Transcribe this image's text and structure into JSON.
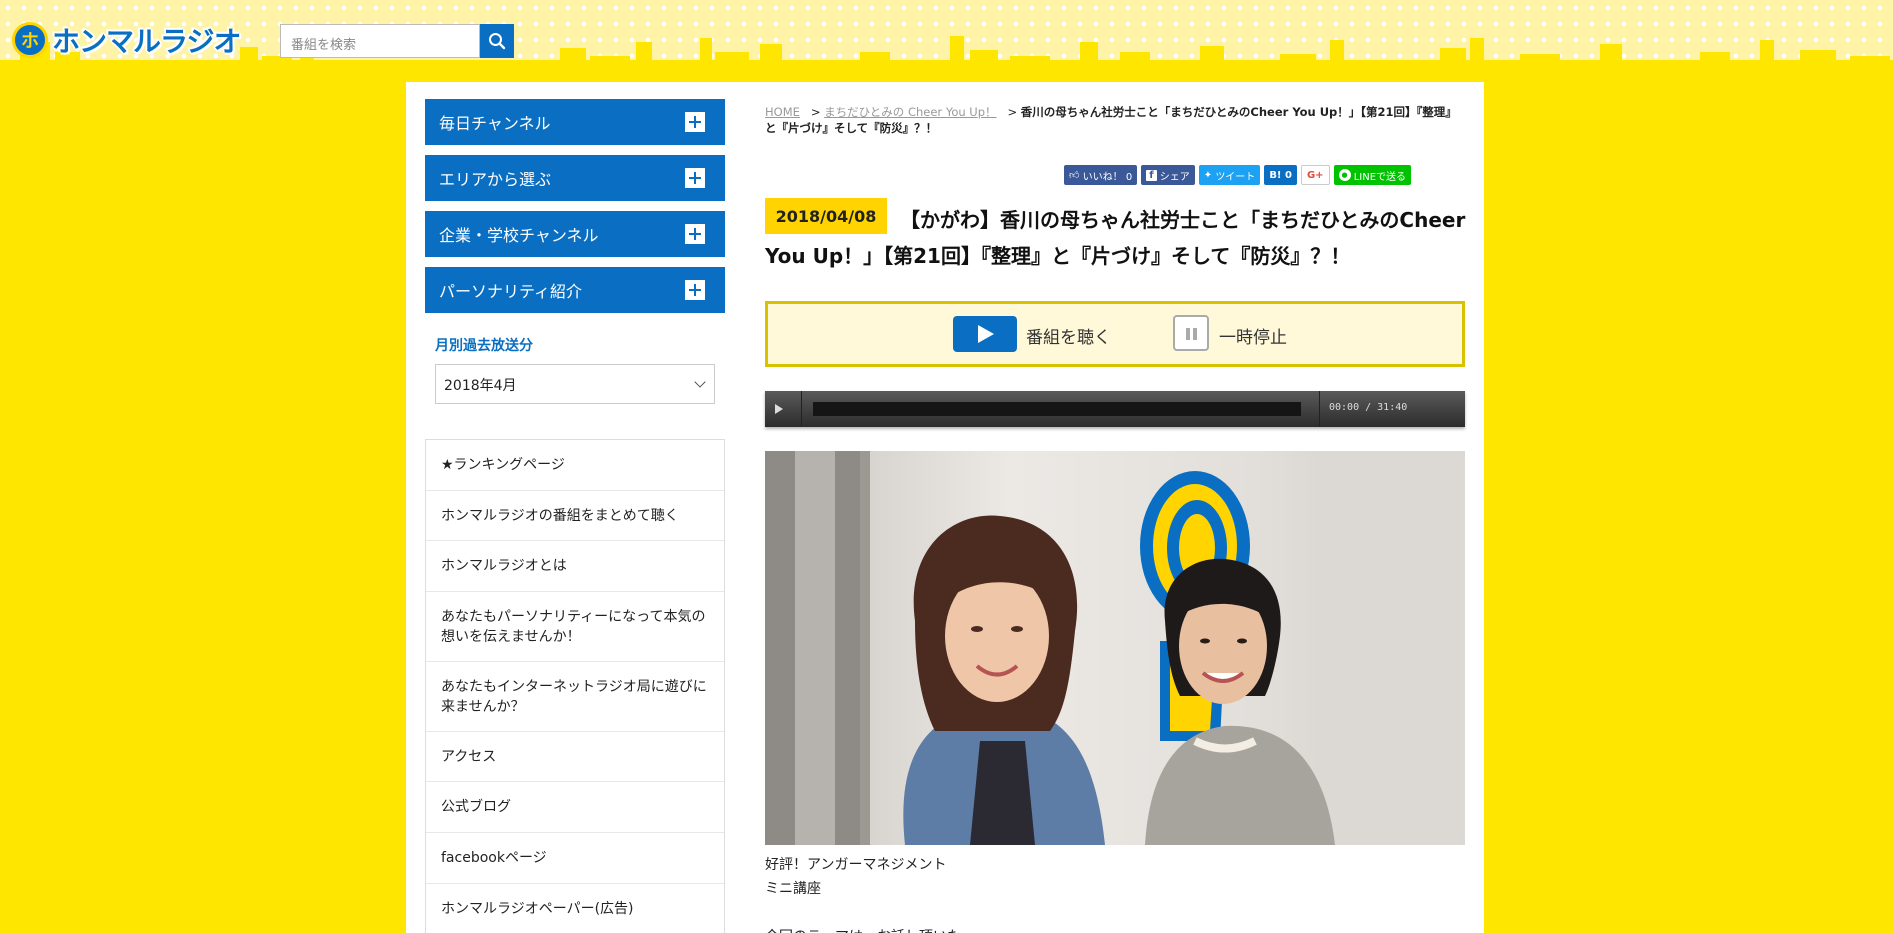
{
  "header": {
    "logo_badge": "ホ",
    "logo_text": "ホンマルラジオ",
    "search_placeholder": "番組を検索"
  },
  "sidebar": {
    "menu": [
      {
        "label": "毎日チャンネル"
      },
      {
        "label": "エリアから選ぶ"
      },
      {
        "label": "企業・学校チャンネル"
      },
      {
        "label": "パーソナリティ紹介"
      }
    ],
    "monthly_title": "月別過去放送分",
    "month_selected": "2018年4月",
    "links": [
      {
        "label": "★ランキングページ"
      },
      {
        "label": "ホンマルラジオの番組をまとめて聴く"
      },
      {
        "label": "ホンマルラジオとは"
      },
      {
        "label": "あなたもパーソナリティーになって本気の想いを伝えませんか！"
      },
      {
        "label": "あなたもインターネットラジオ局に遊びに来ませんか？"
      },
      {
        "label": "アクセス"
      },
      {
        "label": "公式ブログ"
      },
      {
        "label": "facebookページ"
      },
      {
        "label": "ホンマルラジオペーパー(広告)"
      }
    ]
  },
  "breadcrumb": {
    "home": "HOME",
    "sep": ">",
    "program": "まちだひとみの Cheer You Up！",
    "current": "香川の母ちゃん社労士こと「まちだひとみのCheer You Up！」【第21回】『整理』と『片づけ』そして『防災』？！"
  },
  "share": {
    "like": "いいね！ 0",
    "fb_share": "シェア",
    "tweet": "ツイート",
    "hatena": "B! 0",
    "gplus": "G+",
    "line": "LINEで送る"
  },
  "article": {
    "date": "2018/04/08",
    "title": "【かがわ】香川の母ちゃん社労士こと「まちだひとみのCheer You Up！」【第21回】『整理』と『片づけ』そして『防災』？！",
    "listen_label": "番組を聴く",
    "pause_label": "一時停止",
    "audio_time": "00:00 / 31:40",
    "body_lines": [
      "好評！アンガーマネジメント",
      "ミニ講座",
      "",
      "今回のテーマは、お話し頂いた"
    ]
  },
  "colors": {
    "brand_blue": "#0a6fc2",
    "page_yellow": "#ffe600",
    "badge_yellow": "#ffd400"
  }
}
